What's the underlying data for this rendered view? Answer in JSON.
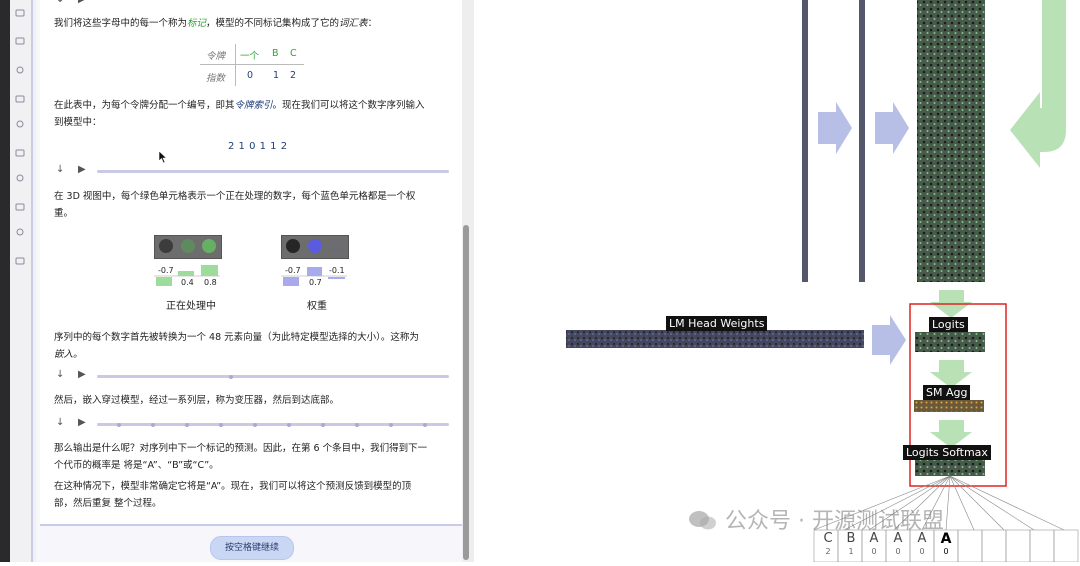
{
  "tutorial": {
    "para1_prefix": "我们将这些字母中的每一个称为",
    "para1_term1": "标记",
    "para1_mid": "，模型的不同标记集构成了它的",
    "para1_term2": "词汇表",
    "para1_suffix": "：",
    "table": {
      "row1_label": "令牌",
      "row1_values": [
        "一个",
        "B",
        "C"
      ],
      "row2_label": "指数",
      "row2_values": [
        "0",
        "1",
        "2"
      ]
    },
    "para2_line1_prefix": "在此表中，为每个令牌分配一个编号，即其",
    "para2_term": "令牌索引",
    "para2_line1_suffix": "。现在我们可以将这个数字序列输入",
    "para2_line2": "到模型中：",
    "sequence": "2 1 0 1 1 2",
    "para3_line1": "在 3D 视图中，每个绿色单元格表示一个正在处理的数字，每个蓝色单元格都是一个权",
    "para3_line2": "重。",
    "processing": {
      "values": [
        "-0.7",
        "0.4",
        "0.8"
      ],
      "label": "正在处理中"
    },
    "weights": {
      "values": [
        "-0.7",
        "0.7",
        "-0.1"
      ],
      "label": "权重"
    },
    "para4_line1": "序列中的每个数字首先被转换为一个 48 元素向量（为此特定模型选择的大小）。这称为",
    "para4_line2": "嵌入。",
    "para5": "然后，嵌入穿过模型，经过一系列层，称为变压器，然后到达底部。",
    "para6_line1": "那么输出是什么呢？对序列中下一个标记的预测。因此，在第 6 个条目中，我们得到下一",
    "para6_line2": "个代币的概率是 将是“A”、“B”或“C”。",
    "para7_line1": "在这种情况下，模型非常确定它将是“A”。现在，我们可以将这个预测反馈到模型的顶",
    "para7_line2": "部，然后重复 整个过程。",
    "continue_button": "按空格键继续"
  },
  "view3d": {
    "label_lm_head": "LM Head Weights",
    "label_logits": "Logits",
    "label_sm_agg": "SM Agg",
    "label_logits_softmax": "Logits Softmax",
    "output_tokens": [
      {
        "token": "C",
        "index": "2"
      },
      {
        "token": "B",
        "index": "1"
      },
      {
        "token": "A",
        "index": "0"
      },
      {
        "token": "A",
        "index": "0"
      },
      {
        "token": "A",
        "index": "0"
      },
      {
        "token": "A",
        "index": "0"
      }
    ],
    "watermark": "公众号 · 开源测试联盟",
    "highlight_color": "#e02424"
  }
}
